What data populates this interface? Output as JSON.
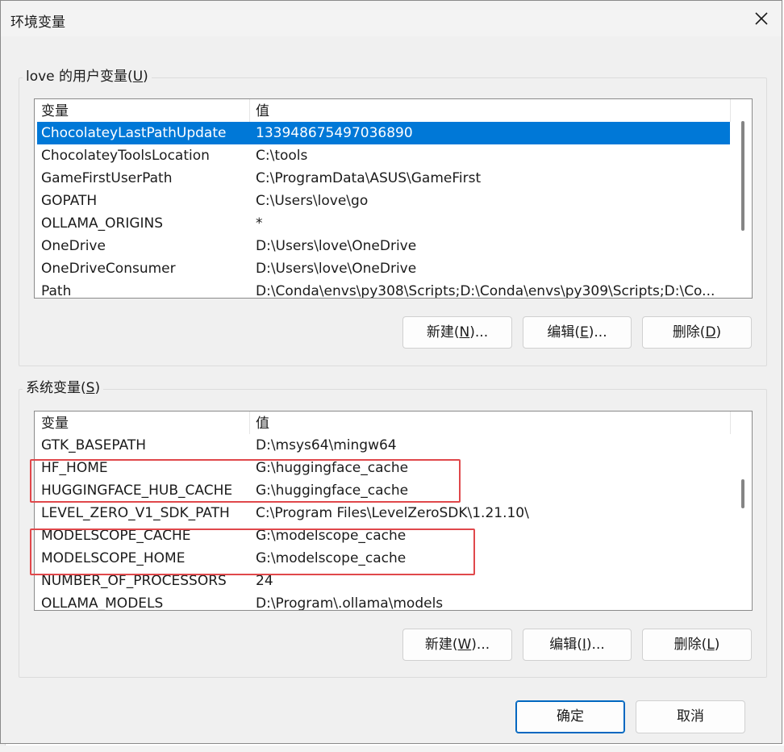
{
  "window": {
    "title": "环境变量",
    "close_icon": "close-icon"
  },
  "user_vars": {
    "group_title_prefix": "love 的用户变量(",
    "group_title_key": "U",
    "group_title_suffix": ")",
    "col_name": "变量",
    "col_value": "值",
    "rows": [
      {
        "name": "ChocolateyLastPathUpdate",
        "value": "133948675497036890"
      },
      {
        "name": "ChocolateyToolsLocation",
        "value": "C:\\tools"
      },
      {
        "name": "GameFirstUserPath",
        "value": "C:\\ProgramData\\ASUS\\GameFirst"
      },
      {
        "name": "GOPATH",
        "value": "C:\\Users\\love\\go"
      },
      {
        "name": "OLLAMA_ORIGINS",
        "value": "*"
      },
      {
        "name": "OneDrive",
        "value": "D:\\Users\\love\\OneDrive"
      },
      {
        "name": "OneDriveConsumer",
        "value": "D:\\Users\\love\\OneDrive"
      },
      {
        "name": "Path",
        "value": "D:\\Conda\\envs\\py308\\Scripts;D:\\Conda\\envs\\py309\\Scripts;D:\\Co..."
      }
    ],
    "selected_index": 0,
    "buttons": {
      "new_prefix": "新建(",
      "new_key": "N",
      "new_suffix": ")...",
      "edit_prefix": "编辑(",
      "edit_key": "E",
      "edit_suffix": ")...",
      "delete_prefix": "删除(",
      "delete_key": "D",
      "delete_suffix": ")"
    }
  },
  "system_vars": {
    "group_title_prefix": "系统变量(",
    "group_title_key": "S",
    "group_title_suffix": ")",
    "col_name": "变量",
    "col_value": "值",
    "rows": [
      {
        "name": "GTK_BASEPATH",
        "value": "D:\\msys64\\mingw64"
      },
      {
        "name": "HF_HOME",
        "value": "G:\\huggingface_cache"
      },
      {
        "name": "HUGGINGFACE_HUB_CACHE",
        "value": "G:\\huggingface_cache"
      },
      {
        "name": "LEVEL_ZERO_V1_SDK_PATH",
        "value": "C:\\Program Files\\LevelZeroSDK\\1.21.10\\"
      },
      {
        "name": "MODELSCOPE_CACHE",
        "value": "G:\\modelscope_cache"
      },
      {
        "name": "MODELSCOPE_HOME",
        "value": "G:\\modelscope_cache"
      },
      {
        "name": "NUMBER_OF_PROCESSORS",
        "value": "24"
      },
      {
        "name": "OLLAMA_MODELS",
        "value": "D:\\Program\\.ollama\\models"
      }
    ],
    "buttons": {
      "new_prefix": "新建(",
      "new_key": "W",
      "new_suffix": ")...",
      "edit_prefix": "编辑(",
      "edit_key": "I",
      "edit_suffix": ")...",
      "delete_prefix": "删除(",
      "delete_key": "L",
      "delete_suffix": ")"
    }
  },
  "footer": {
    "ok_label": "确定",
    "cancel_label": "取消"
  },
  "colors": {
    "selection": "#0078d7",
    "highlight_box": "#e0484b",
    "dialog_bg": "#f0f0f0"
  }
}
